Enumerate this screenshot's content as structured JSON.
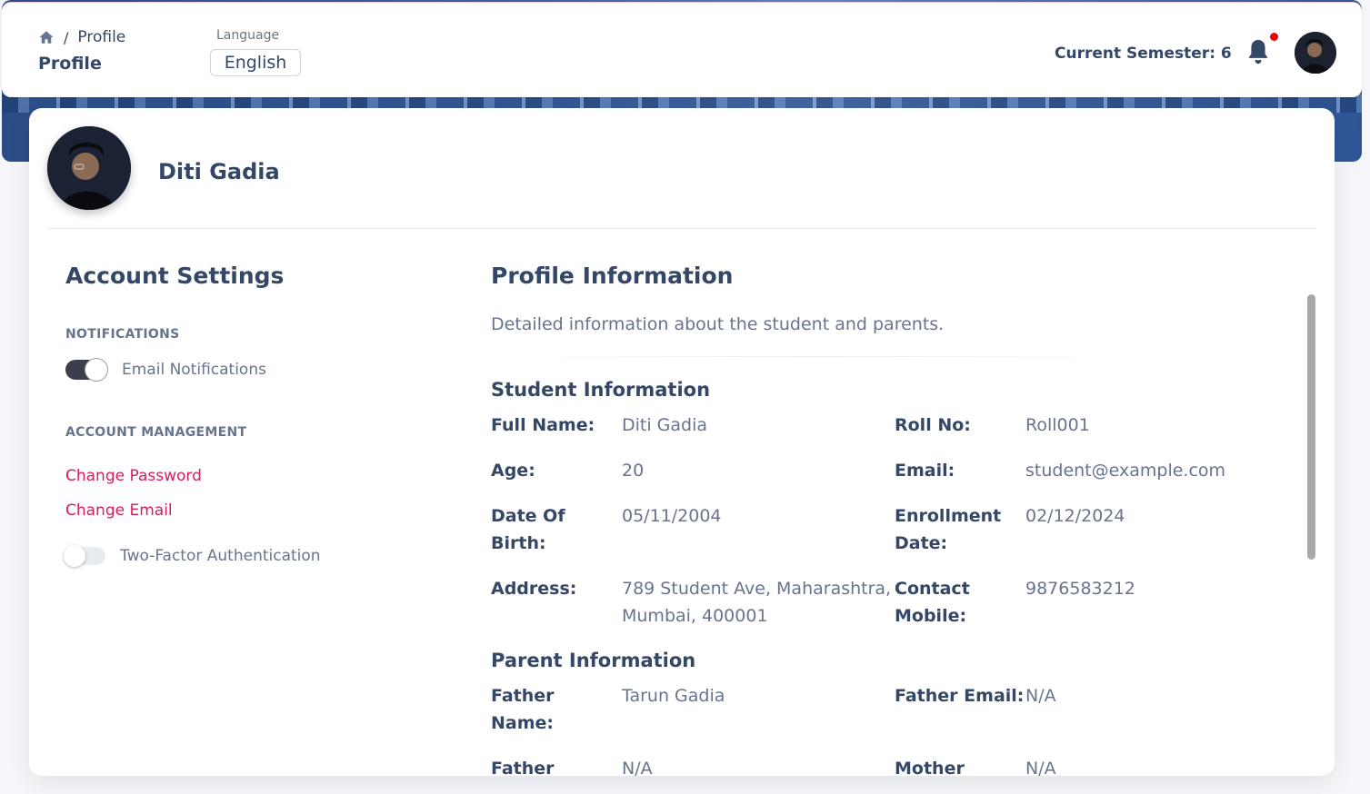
{
  "header": {
    "breadcrumb": {
      "current": "Profile",
      "separator": "/"
    },
    "page_title": "Profile",
    "language": {
      "label": "Language",
      "selected": "English"
    },
    "semester_text": "Current Semester: 6",
    "notification_badge_color": "#ea0606"
  },
  "profile": {
    "name": "Diti Gadia"
  },
  "account_settings": {
    "title": "Account Settings",
    "notifications_heading": "NOTIFICATIONS",
    "email_notifications": {
      "label": "Email Notifications",
      "enabled": true
    },
    "management_heading": "ACCOUNT MANAGEMENT",
    "change_password": "Change Password",
    "change_email": "Change Email",
    "two_factor": {
      "label": "Two-Factor Authentication",
      "enabled": false
    }
  },
  "profile_info": {
    "title": "Profile Information",
    "description": "Detailed information about the student and parents.",
    "student_heading": "Student Information",
    "student_fields": [
      {
        "key": "Full Name:",
        "value": "Diti Gadia"
      },
      {
        "key": "Roll No:",
        "value": "Roll001"
      },
      {
        "key": "Age:",
        "value": "20"
      },
      {
        "key": "Email:",
        "value": "student@example.com"
      },
      {
        "key": "Date Of Birth:",
        "value": "05/11/2004"
      },
      {
        "key": "Enrollment Date:",
        "value": "02/12/2024"
      },
      {
        "key": "Address:",
        "value": "789 Student Ave, Maharashtra, Mumbai, 400001"
      },
      {
        "key": "Contact Mobile:",
        "value": "9876583212"
      }
    ],
    "parent_heading": "Parent Information",
    "parent_fields": [
      {
        "key": "Father Name:",
        "value": "Tarun Gadia"
      },
      {
        "key": "Father Email:",
        "value": "N/A"
      },
      {
        "key": "Father Mobile:",
        "value": "N/A"
      },
      {
        "key": "Mother Name:",
        "value": "N/A"
      }
    ]
  },
  "colors": {
    "accent_link": "#d81b60",
    "text_primary": "#344767",
    "text_secondary": "#67748e",
    "banner": "#2b4c86"
  }
}
